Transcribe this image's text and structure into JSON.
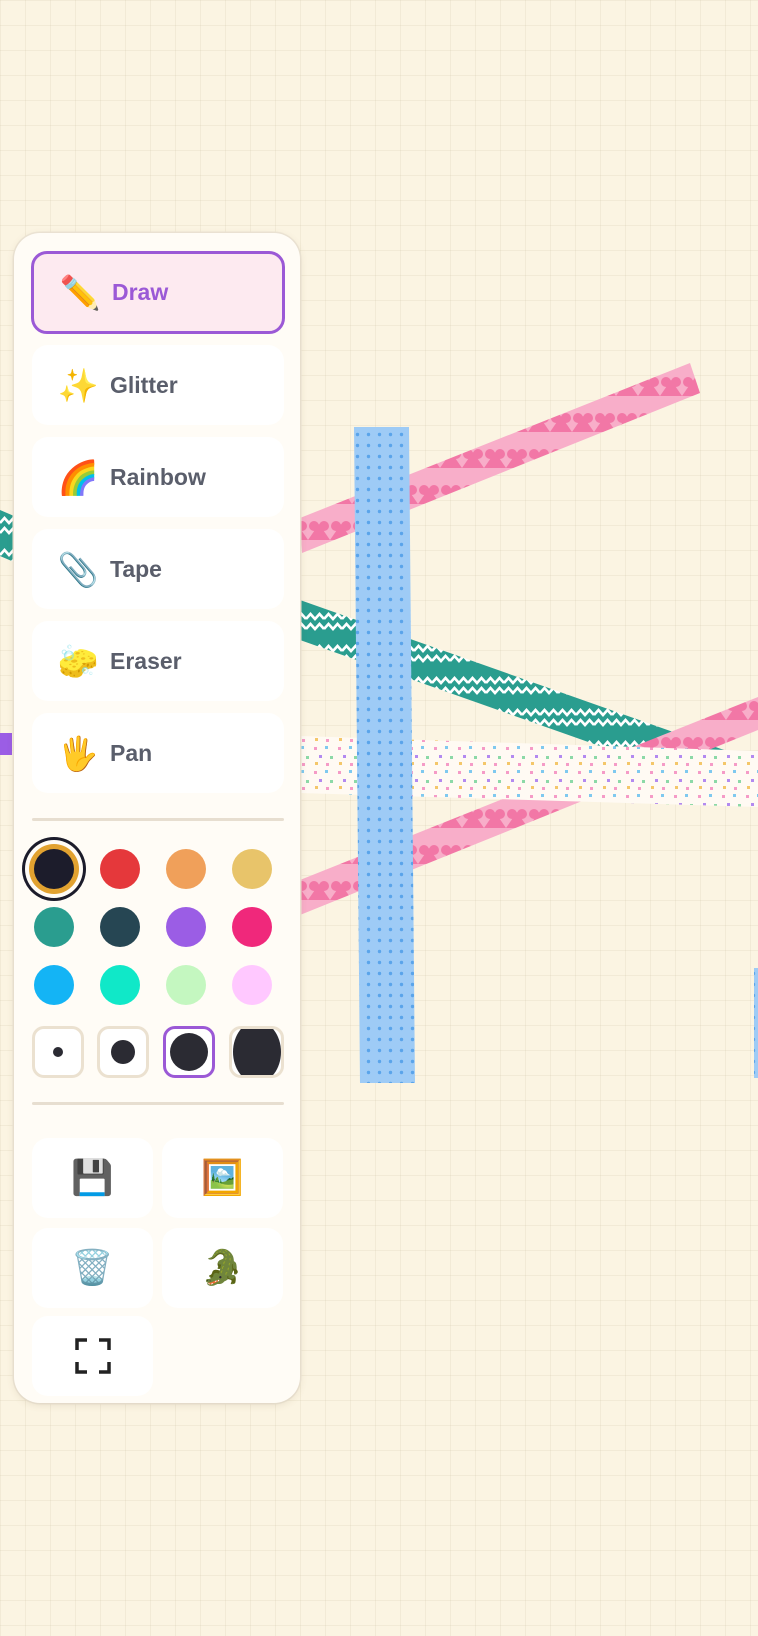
{
  "tools": [
    {
      "label": "Draw",
      "icon": "✏️",
      "active": true
    },
    {
      "label": "Glitter",
      "icon": "✨",
      "active": false
    },
    {
      "label": "Rainbow",
      "icon": "🌈",
      "active": false
    },
    {
      "label": "Tape",
      "icon": "📎",
      "active": false
    },
    {
      "label": "Eraser",
      "icon": "🧽",
      "active": false
    },
    {
      "label": "Pan",
      "icon": "🖐️",
      "active": false
    }
  ],
  "palette": {
    "selected_index": 0,
    "colors": [
      "#1c1c2b",
      "#e5383b",
      "#f0a05a",
      "#e8c46a",
      "#2a9d8f",
      "#264653",
      "#9b5de5",
      "#f0287b",
      "#14b4f5",
      "#10e8c8",
      "#c4f7c0",
      "#ffc8ff"
    ]
  },
  "brush_sizes": {
    "selected_index": 2,
    "options": [
      "small",
      "medium",
      "large",
      "extra-large"
    ]
  },
  "actions": {
    "save_icon": "💾",
    "image_icon": "🖼️",
    "trash_icon": "🗑️",
    "crocodile_icon": "🐊",
    "fullscreen_icon": "fullscreen-corners"
  }
}
